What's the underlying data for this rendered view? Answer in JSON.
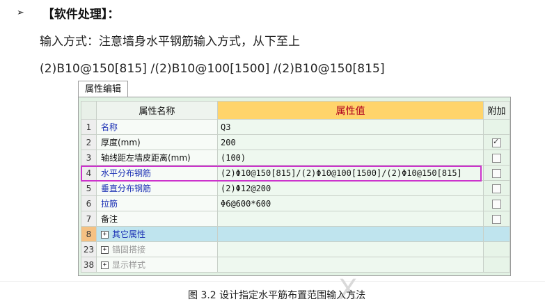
{
  "heading": {
    "bullet": "➢",
    "text": "【软件处理】："
  },
  "line1": "输入方式：注意墙身水平钢筋输入方式，从下至上",
  "line2": "(2)B10@150[815] /(2)B10@100[1500] /(2)B10@150[815]",
  "tab_label": "属性编辑",
  "columns": {
    "name": "属性名称",
    "value": "属性值",
    "add": "附加"
  },
  "rows": [
    {
      "num": "1",
      "name": "名称",
      "value": "Q3",
      "checkbox": false,
      "checked": false
    },
    {
      "num": "2",
      "name": "厚度(mm)",
      "value": "200",
      "checkbox": true,
      "checked": true
    },
    {
      "num": "3",
      "name": "轴线距左墙皮距离(mm)",
      "value": "(100)",
      "checkbox": true,
      "checked": false
    },
    {
      "num": "4",
      "name": "水平分布钢筋",
      "value": "(2)Φ10@150[815]/(2)Φ10@100[1500]/(2)Φ10@150[815]",
      "checkbox": true,
      "checked": false
    },
    {
      "num": "5",
      "name": "垂直分布钢筋",
      "value": "(2)Φ12@200",
      "checkbox": true,
      "checked": false
    },
    {
      "num": "6",
      "name": "拉筋",
      "value": "Φ6@600*600",
      "checkbox": true,
      "checked": false
    },
    {
      "num": "7",
      "name": "备注",
      "value": "",
      "checkbox": true,
      "checked": false
    },
    {
      "num": "8",
      "name": "其它属性",
      "expand": "+"
    },
    {
      "num": "23",
      "name": "锚固搭接",
      "expand": "+"
    },
    {
      "num": "38",
      "name": "显示样式",
      "expand": "+"
    }
  ],
  "caption": "图 3.2  设计指定水平筋布置范围输入方法",
  "watermark": "X"
}
